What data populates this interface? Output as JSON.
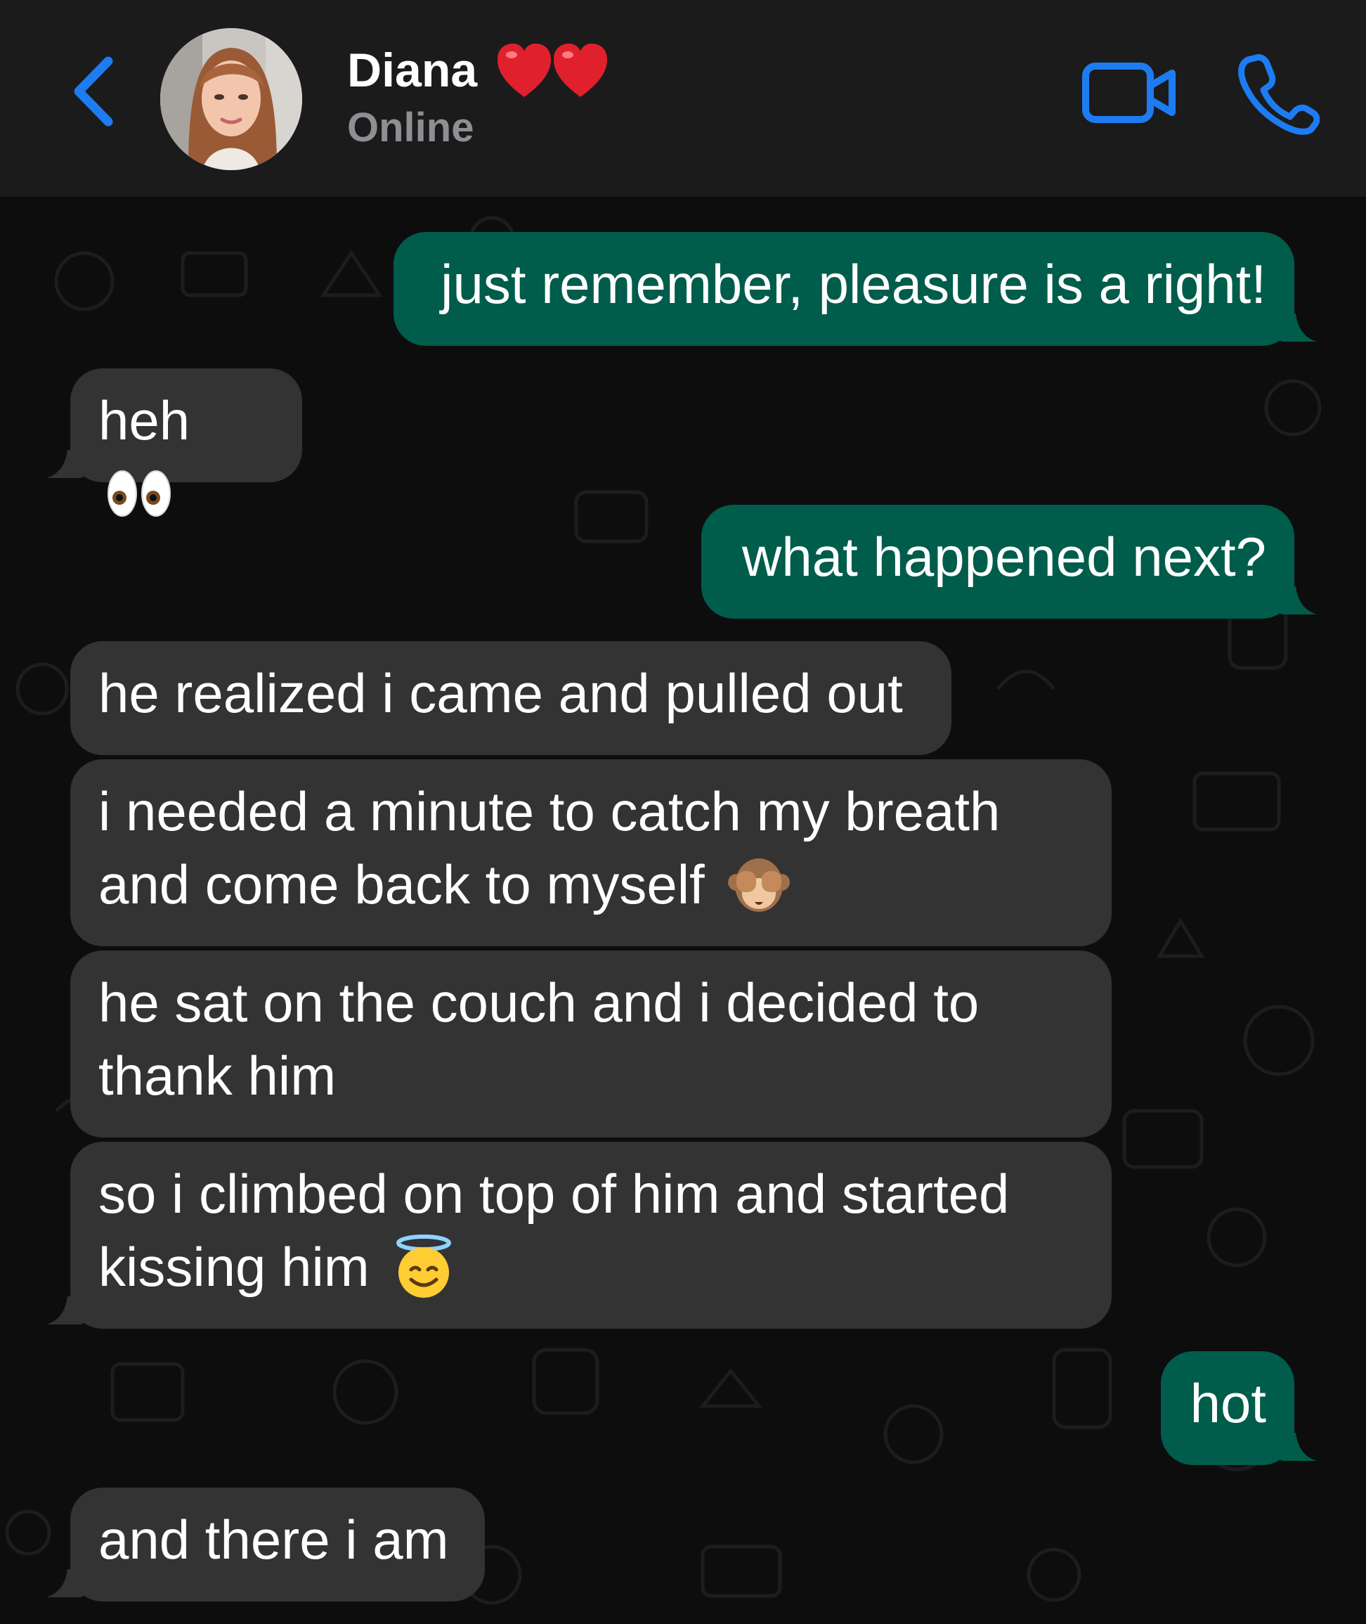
{
  "header": {
    "contact_name": "Diana",
    "name_emoji": "heart-icon heart-icon",
    "status": "Online",
    "icons": {
      "back": "chevron-left-icon",
      "video": "video-camera-icon",
      "call": "phone-icon"
    }
  },
  "messages": [
    {
      "direction": "sent",
      "text": "just remember, pleasure is a right!"
    },
    {
      "direction": "received",
      "text": "heh",
      "emoji": "eyes-icon"
    },
    {
      "direction": "sent",
      "text": "what happened next?"
    },
    {
      "direction": "received",
      "text": "he realized i came and pulled out"
    },
    {
      "direction": "received",
      "line1": "i needed a minute to catch my breath",
      "line2": "and come back to myself",
      "emoji": "see-no-evil-monkey-icon"
    },
    {
      "direction": "received",
      "line1": "he sat on the couch and i decided to",
      "line2": "thank him"
    },
    {
      "direction": "received",
      "line1": "so i climbed on top of him and started",
      "line2": "kissing him",
      "emoji": "smiling-face-with-halo-icon"
    },
    {
      "direction": "sent",
      "text": "hot"
    },
    {
      "direction": "received",
      "text": "and there i am"
    }
  ],
  "colors": {
    "header_bg": "#1b1b1c",
    "chat_bg": "#0d0d0e",
    "sent_bubble": "#005c4b",
    "received_bubble": "#333334",
    "accent_blue": "#1e7cf2",
    "status_gray": "#8e8e93"
  }
}
